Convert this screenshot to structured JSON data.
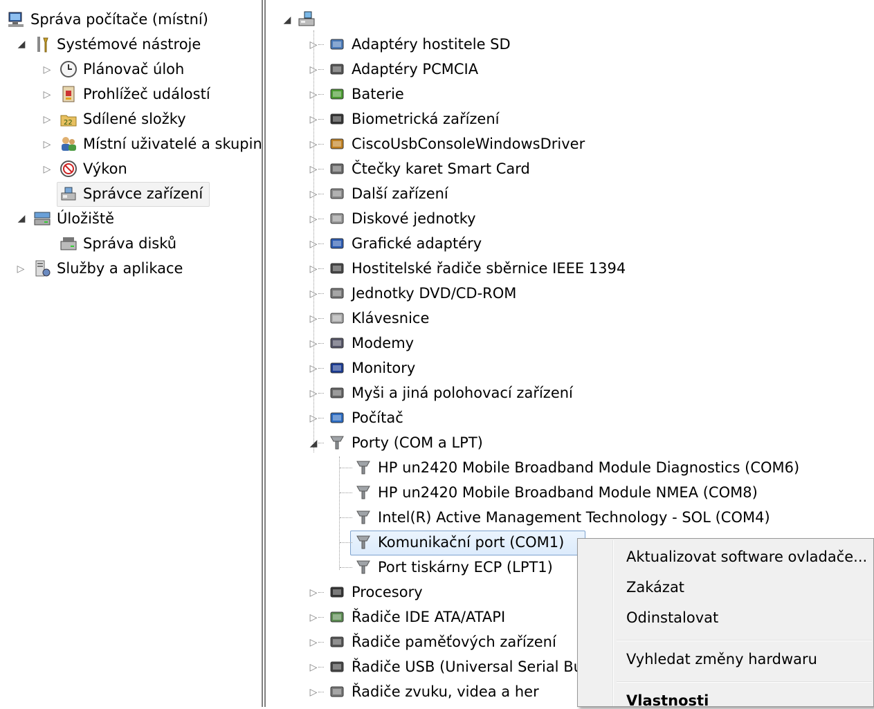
{
  "left_tree": {
    "root": "Správa počítače (místní)",
    "system_tools": "Systémové nástroje",
    "task_scheduler": "Plánovač úloh",
    "event_viewer": "Prohlížeč událostí",
    "shared_folders": "Sdílené složky",
    "local_users": "Místní uživatelé a skupiny",
    "performance": "Výkon",
    "device_manager": "Správce zařízení",
    "storage": "Úložiště",
    "disk_management": "Správa disků",
    "services_apps": "Služby a aplikace"
  },
  "device_tree": {
    "categories": [
      "Adaptéry hostitele SD",
      "Adaptéry PCMCIA",
      "Baterie",
      "Biometrická zařízení",
      "CiscoUsbConsoleWindowsDriver",
      "Čtečky karet Smart Card",
      "Další zařízení",
      "Diskové jednotky",
      "Grafické adaptéry",
      "Hostitelské řadiče sběrnice IEEE 1394",
      "Jednotky DVD/CD-ROM",
      "Klávesnice",
      "Modemy",
      "Monitory",
      "Myši a jiná polohovací zařízení",
      "Počítač",
      "Porty (COM a LPT)"
    ],
    "ports": [
      "HP un2420 Mobile Broadband Module Diagnostics (COM6)",
      "HP un2420 Mobile Broadband Module NMEA (COM8)",
      "Intel(R) Active Management Technology - SOL (COM4)",
      "Komunikační port (COM1)",
      "Port tiskárny ECP (LPT1)"
    ],
    "after": [
      "Procesory",
      "Řadiče IDE ATA/ATAPI",
      "Řadiče paměťových zařízení",
      "Řadiče USB (Universal Serial Bus)",
      "Řadiče zvuku, videa a her"
    ]
  },
  "context_menu": {
    "update_driver": "Aktualizovat software ovladače...",
    "disable": "Zakázat",
    "uninstall": "Odinstalovat",
    "scan": "Vyhledat změny hardwaru",
    "properties": "Vlastnosti"
  }
}
